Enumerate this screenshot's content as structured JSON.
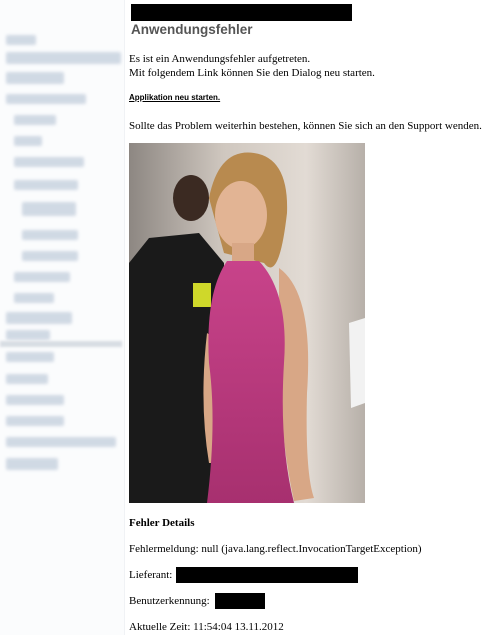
{
  "header": {
    "title": "Anwendungsfehler"
  },
  "message": {
    "line1": "Es ist ein Anwendungsfehler aufgetreten.",
    "line2": "Mit folgendem Link können Sie den Dialog neu starten.",
    "restart_link": "Applikation neu starten.",
    "support_note": "Sollte das Problem weiterhin bestehen, können Sie sich an den Support wenden."
  },
  "details": {
    "title": "Fehler Details",
    "error_message": "Fehlermeldung: null (java.lang.reflect.InvocationTargetException)",
    "supplier_label": "Lieferant:",
    "user_label": "Benutzerkennung:",
    "time": "Aktuelle Zeit: 11:54:04 13.11.2012"
  },
  "colors": {
    "title_gray": "#555555",
    "sidebar_blur": "#c9d3e0",
    "redaction": "#000000"
  }
}
